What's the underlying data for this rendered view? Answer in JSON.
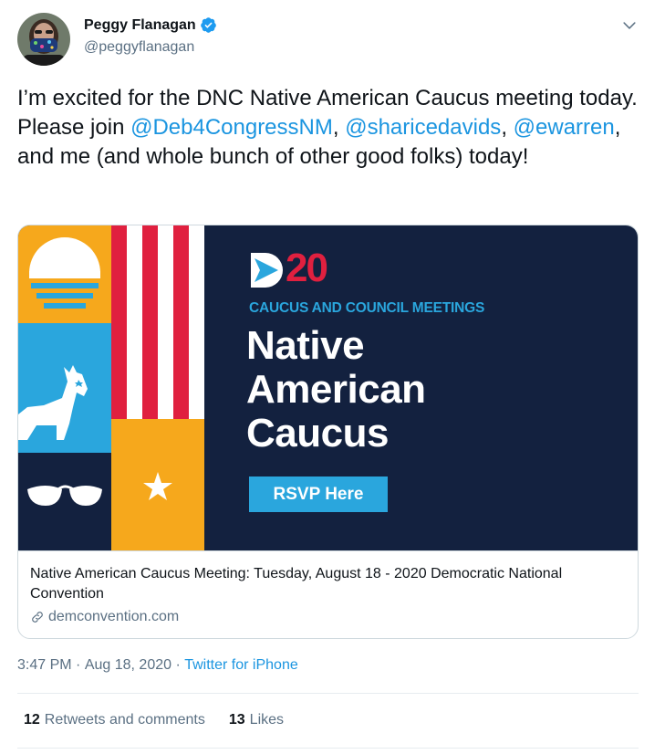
{
  "author": {
    "name": "Peggy Flanagan",
    "handle": "@peggyflanagan"
  },
  "tweet": {
    "text_parts": {
      "p1": "I’m excited for the DNC Native American Caucus meeting today. Please join ",
      "m1": "@Deb4CongressNM",
      "p2": ",",
      "m2": "@sharicedavids",
      "p3": ", ",
      "m3": "@ewarren",
      "p4": ", and me (and whole bunch of other good folks) today!"
    }
  },
  "card": {
    "image": {
      "d20_logo_text": "20",
      "subtitle": "CAUCUS AND COUNCIL MEETINGS",
      "title_line1": "Native",
      "title_line2": "American",
      "title_line3": "Caucus",
      "button_label": "RSVP Here"
    },
    "title": "Native American Caucus Meeting: Tuesday, August 18 - 2020 Democratic National Convention",
    "domain": "demconvention.com"
  },
  "meta": {
    "time": "3:47 PM",
    "separator": " · ",
    "date": "Aug 18, 2020",
    "separator2": " · ",
    "source": "Twitter for iPhone"
  },
  "stats": {
    "retweets_count": "12",
    "retweets_label": "Retweets and comments",
    "likes_count": "13",
    "likes_label": "Likes"
  },
  "colors": {
    "link": "#1b95e0",
    "card_bg": "#13213f",
    "accent_blue": "#2aa6dd",
    "red": "#e0203f",
    "yellow": "#f6a81c"
  }
}
